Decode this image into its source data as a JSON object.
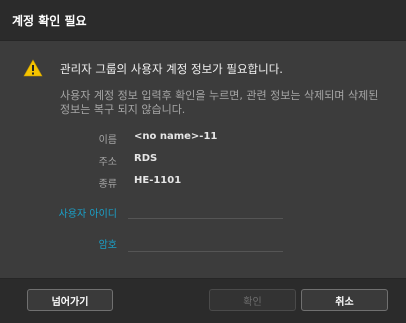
{
  "dialog": {
    "title": "계정 확인 필요",
    "headline": "관리자 그룹의 사용자 계정 정보가 필요합니다.",
    "description": "사용자 계정 정보 입력후 확인을 누르면, 관련 정보는 삭제되며 삭제된 정보는 복구 되지 않습니다.",
    "info": {
      "name_label": "이름",
      "name_value": "<no name>-11",
      "address_label": "주소",
      "address_value": "RDS",
      "type_label": "종류",
      "type_value": "HE-1101"
    },
    "fields": {
      "user_id_label": "사용자 아이디",
      "user_id_value": "",
      "password_label": "암호",
      "password_value": ""
    },
    "buttons": {
      "skip": "넘어가기",
      "confirm": "확인",
      "cancel": "취소"
    }
  },
  "colors": {
    "background": "#3c3c3c",
    "bar": "#2b2b2b",
    "accent": "#1aa0c8",
    "warning": "#f5c400"
  },
  "icons": {
    "warning": "warning-triangle-icon"
  }
}
